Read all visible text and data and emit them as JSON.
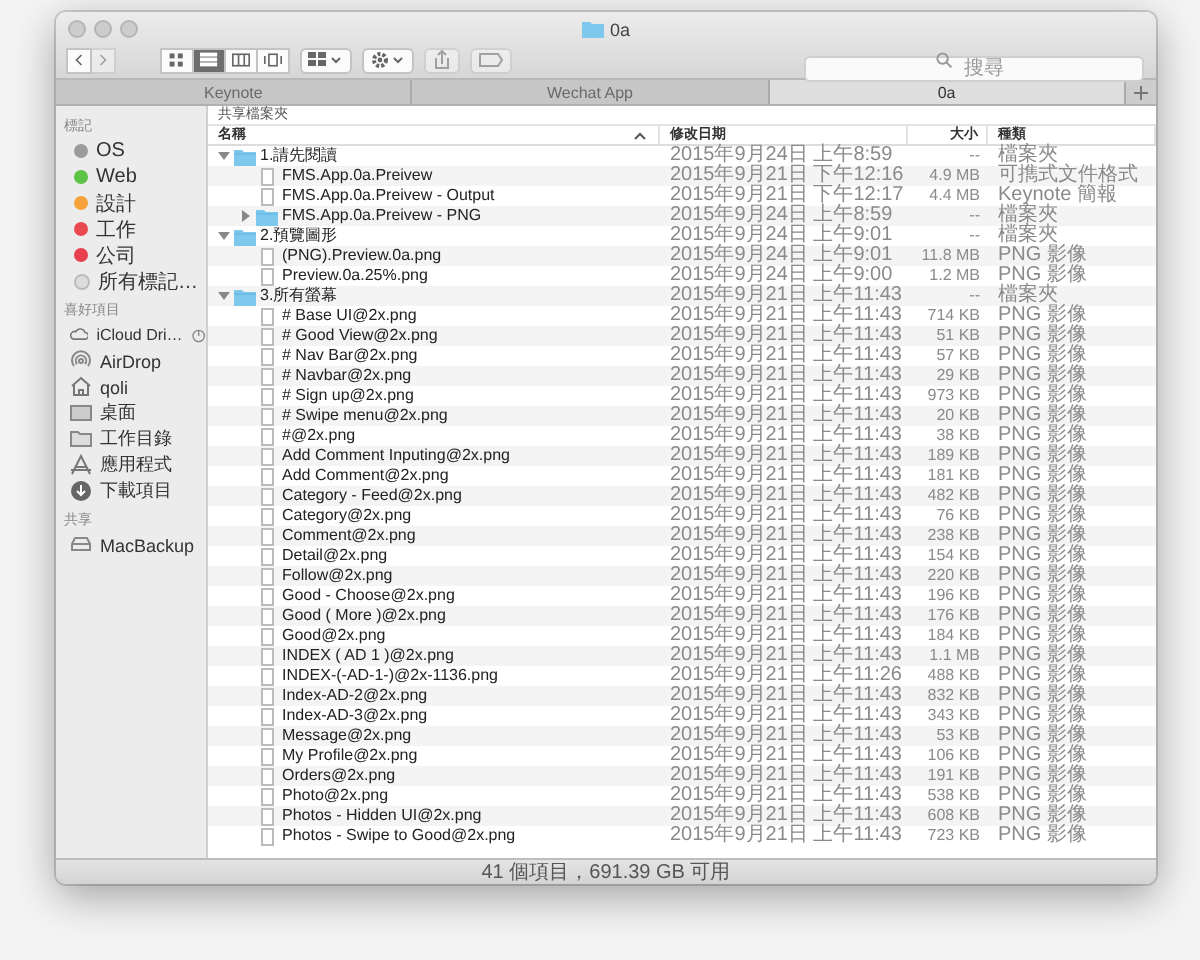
{
  "window": {
    "title": "0a"
  },
  "toolbar": {
    "nav": [
      {
        "kind": "back",
        "disabled": false
      },
      {
        "kind": "forward",
        "disabled": true
      }
    ],
    "views": [
      {
        "kind": "icons",
        "selected": false
      },
      {
        "kind": "list",
        "selected": true
      },
      {
        "kind": "columns",
        "selected": false
      },
      {
        "kind": "coverflow",
        "selected": false
      }
    ],
    "buttons": [
      {
        "kind": "arrange",
        "disabled": false
      },
      {
        "kind": "action",
        "disabled": false
      },
      {
        "kind": "share",
        "disabled": true
      },
      {
        "kind": "tags",
        "disabled": true
      }
    ],
    "search": {
      "placeholder": "搜尋"
    }
  },
  "tabs": [
    {
      "label": "Keynote",
      "selected": false
    },
    {
      "label": "Wechat App",
      "selected": false
    },
    {
      "label": "0a",
      "selected": true
    }
  ],
  "sidebar": {
    "sections": [
      {
        "title": "標記",
        "items": [
          {
            "kind": "tag",
            "label": "OS",
            "color": "#9b9b9b"
          },
          {
            "kind": "tag",
            "label": "Web",
            "color": "#5cc346"
          },
          {
            "kind": "tag",
            "label": "設計",
            "color": "#f5a33a"
          },
          {
            "kind": "tag",
            "label": "工作",
            "color": "#ea4a4f"
          },
          {
            "kind": "tag",
            "label": "公司",
            "color": "#e8414d"
          },
          {
            "kind": "all-tags",
            "label": "所有標記…"
          }
        ]
      },
      {
        "title": "喜好項目",
        "items": [
          {
            "kind": "icloud",
            "label": "iCloud Dri…"
          },
          {
            "kind": "airdrop",
            "label": "AirDrop"
          },
          {
            "kind": "home",
            "label": "qoli"
          },
          {
            "kind": "desktop",
            "label": "桌面"
          },
          {
            "kind": "folder",
            "label": "工作目錄"
          },
          {
            "kind": "apps",
            "label": "應用程式"
          },
          {
            "kind": "downloads",
            "label": "下載項目"
          }
        ]
      },
      {
        "title": "共享",
        "items": [
          {
            "kind": "drive",
            "label": "MacBackup"
          }
        ]
      }
    ]
  },
  "path_bar": {
    "label": "共享檔案夾"
  },
  "columns": [
    {
      "label": "名稱",
      "sorted": true
    },
    {
      "label": "修改日期",
      "sorted": false
    },
    {
      "label": "大小",
      "sorted": false
    },
    {
      "label": "種類",
      "sorted": false
    }
  ],
  "tree": [
    {
      "kind": "folder",
      "name": "1.請先閱讀",
      "date": "2015年9月24日 上午8:59",
      "size": "--",
      "file_type": "檔案夾",
      "expanded": true,
      "children": [
        {
          "kind": "file",
          "name": "FMS.App.0a.Preivew",
          "date": "2015年9月21日 下午12:16",
          "size": "4.9 MB",
          "file_type": "可擕式文件格式"
        },
        {
          "kind": "file",
          "name": "FMS.App.0a.Preivew - Output",
          "date": "2015年9月21日 下午12:17",
          "size": "4.4 MB",
          "file_type": "Keynote 簡報"
        },
        {
          "kind": "folder",
          "name": "FMS.App.0a.Preivew - PNG",
          "date": "2015年9月24日 上午8:59",
          "size": "--",
          "file_type": "檔案夾",
          "expanded": false
        }
      ]
    },
    {
      "kind": "folder",
      "name": "2.預覽圖形",
      "date": "2015年9月24日 上午9:01",
      "size": "--",
      "file_type": "檔案夾",
      "expanded": true,
      "children": [
        {
          "kind": "file",
          "name": "(PNG).Preview.0a.png",
          "date": "2015年9月24日 上午9:01",
          "size": "11.8 MB",
          "file_type": "PNG 影像"
        },
        {
          "kind": "file",
          "name": "Preview.0a.25%.png",
          "date": "2015年9月24日 上午9:00",
          "size": "1.2 MB",
          "file_type": "PNG 影像"
        }
      ]
    },
    {
      "kind": "folder",
      "name": "3.所有螢幕",
      "date": "2015年9月21日 上午11:43",
      "size": "--",
      "file_type": "檔案夾",
      "expanded": true,
      "children": [
        {
          "kind": "file",
          "name": "# Base UI@2x.png",
          "date": "2015年9月21日 上午11:43",
          "size": "714 KB",
          "file_type": "PNG 影像"
        },
        {
          "kind": "file",
          "name": "# Good View@2x.png",
          "date": "2015年9月21日 上午11:43",
          "size": "51 KB",
          "file_type": "PNG 影像"
        },
        {
          "kind": "file",
          "name": "# Nav Bar@2x.png",
          "date": "2015年9月21日 上午11:43",
          "size": "57 KB",
          "file_type": "PNG 影像"
        },
        {
          "kind": "file",
          "name": "# Navbar@2x.png",
          "date": "2015年9月21日 上午11:43",
          "size": "29 KB",
          "file_type": "PNG 影像"
        },
        {
          "kind": "file",
          "name": "# Sign up@2x.png",
          "date": "2015年9月21日 上午11:43",
          "size": "973 KB",
          "file_type": "PNG 影像"
        },
        {
          "kind": "file",
          "name": "# Swipe menu@2x.png",
          "date": "2015年9月21日 上午11:43",
          "size": "20 KB",
          "file_type": "PNG 影像"
        },
        {
          "kind": "file",
          "name": "#@2x.png",
          "date": "2015年9月21日 上午11:43",
          "size": "38 KB",
          "file_type": "PNG 影像"
        },
        {
          "kind": "file",
          "name": "Add Comment Inputing@2x.png",
          "date": "2015年9月21日 上午11:43",
          "size": "189 KB",
          "file_type": "PNG 影像"
        },
        {
          "kind": "file",
          "name": "Add Comment@2x.png",
          "date": "2015年9月21日 上午11:43",
          "size": "181 KB",
          "file_type": "PNG 影像"
        },
        {
          "kind": "file",
          "name": "Category - Feed@2x.png",
          "date": "2015年9月21日 上午11:43",
          "size": "482 KB",
          "file_type": "PNG 影像"
        },
        {
          "kind": "file",
          "name": "Category@2x.png",
          "date": "2015年9月21日 上午11:43",
          "size": "76 KB",
          "file_type": "PNG 影像"
        },
        {
          "kind": "file",
          "name": "Comment@2x.png",
          "date": "2015年9月21日 上午11:43",
          "size": "238 KB",
          "file_type": "PNG 影像"
        },
        {
          "kind": "file",
          "name": "Detail@2x.png",
          "date": "2015年9月21日 上午11:43",
          "size": "154 KB",
          "file_type": "PNG 影像"
        },
        {
          "kind": "file",
          "name": "Follow@2x.png",
          "date": "2015年9月21日 上午11:43",
          "size": "220 KB",
          "file_type": "PNG 影像"
        },
        {
          "kind": "file",
          "name": "Good - Choose@2x.png",
          "date": "2015年9月21日 上午11:43",
          "size": "196 KB",
          "file_type": "PNG 影像"
        },
        {
          "kind": "file",
          "name": "Good ( More )@2x.png",
          "date": "2015年9月21日 上午11:43",
          "size": "176 KB",
          "file_type": "PNG 影像"
        },
        {
          "kind": "file",
          "name": "Good@2x.png",
          "date": "2015年9月21日 上午11:43",
          "size": "184 KB",
          "file_type": "PNG 影像"
        },
        {
          "kind": "file",
          "name": "INDEX ( AD 1 )@2x.png",
          "date": "2015年9月21日 上午11:43",
          "size": "1.1 MB",
          "file_type": "PNG 影像"
        },
        {
          "kind": "file",
          "name": "INDEX-(-AD-1-)@2x-1136.png",
          "date": "2015年9月21日 上午11:26",
          "size": "488 KB",
          "file_type": "PNG 影像"
        },
        {
          "kind": "file",
          "name": "Index-AD-2@2x.png",
          "date": "2015年9月21日 上午11:43",
          "size": "832 KB",
          "file_type": "PNG 影像"
        },
        {
          "kind": "file",
          "name": "Index-AD-3@2x.png",
          "date": "2015年9月21日 上午11:43",
          "size": "343 KB",
          "file_type": "PNG 影像"
        },
        {
          "kind": "file",
          "name": "Message@2x.png",
          "date": "2015年9月21日 上午11:43",
          "size": "53 KB",
          "file_type": "PNG 影像"
        },
        {
          "kind": "file",
          "name": "My Profile@2x.png",
          "date": "2015年9月21日 上午11:43",
          "size": "106 KB",
          "file_type": "PNG 影像"
        },
        {
          "kind": "file",
          "name": "Orders@2x.png",
          "date": "2015年9月21日 上午11:43",
          "size": "191 KB",
          "file_type": "PNG 影像"
        },
        {
          "kind": "file",
          "name": "Photo@2x.png",
          "date": "2015年9月21日 上午11:43",
          "size": "538 KB",
          "file_type": "PNG 影像"
        },
        {
          "kind": "file",
          "name": "Photos - Hidden UI@2x.png",
          "date": "2015年9月21日 上午11:43",
          "size": "608 KB",
          "file_type": "PNG 影像"
        },
        {
          "kind": "file",
          "name": "Photos - Swipe to Good@2x.png",
          "date": "2015年9月21日 上午11:43",
          "size": "723 KB",
          "file_type": "PNG 影像"
        }
      ]
    }
  ],
  "status_bar": {
    "text": "41 個項目，691.39 GB 可用"
  }
}
